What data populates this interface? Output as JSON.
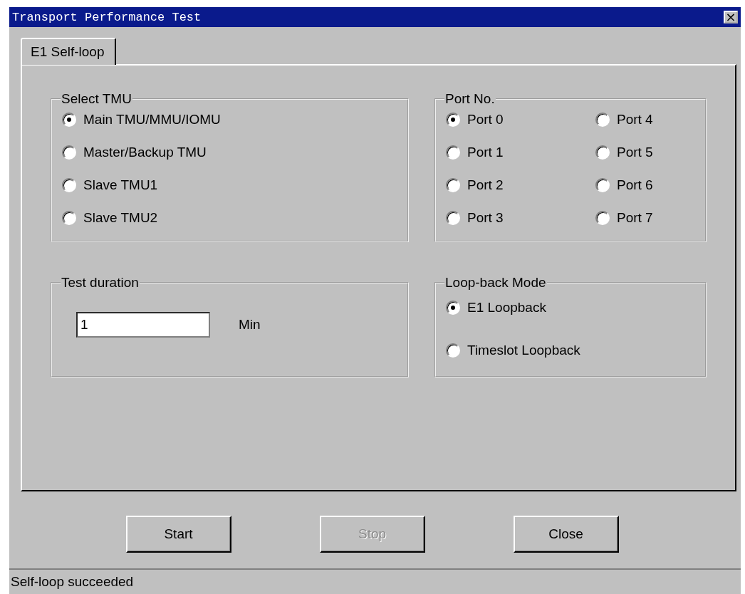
{
  "window": {
    "title": "Transport Performance Test",
    "close": "×"
  },
  "tabs": [
    {
      "label": "E1 Self-loop",
      "selected": true
    }
  ],
  "select_tmu": {
    "title": "Select TMU",
    "options": [
      {
        "label": "Main TMU/MMU/IOMU",
        "selected": true
      },
      {
        "label": "Master/Backup TMU",
        "selected": false
      },
      {
        "label": "Slave TMU1",
        "selected": false
      },
      {
        "label": "Slave TMU2",
        "selected": false
      }
    ]
  },
  "port_no": {
    "title": "Port No.",
    "options": [
      {
        "label": "Port 0",
        "selected": true
      },
      {
        "label": "Port 1",
        "selected": false
      },
      {
        "label": "Port 2",
        "selected": false
      },
      {
        "label": "Port 3",
        "selected": false
      },
      {
        "label": "Port 4",
        "selected": false
      },
      {
        "label": "Port 5",
        "selected": false
      },
      {
        "label": "Port 6",
        "selected": false
      },
      {
        "label": "Port 7",
        "selected": false
      }
    ]
  },
  "test_duration": {
    "title": "Test duration",
    "value": "1",
    "unit": "Min"
  },
  "loopback_mode": {
    "title": "Loop-back Mode",
    "options": [
      {
        "label": "E1 Loopback",
        "selected": true
      },
      {
        "label": "Timeslot Loopback",
        "selected": false
      }
    ]
  },
  "buttons": [
    {
      "label": "Start",
      "disabled": false
    },
    {
      "label": "Stop",
      "disabled": true
    },
    {
      "label": "Close",
      "disabled": false
    }
  ],
  "status_bar": "Self-loop succeeded"
}
